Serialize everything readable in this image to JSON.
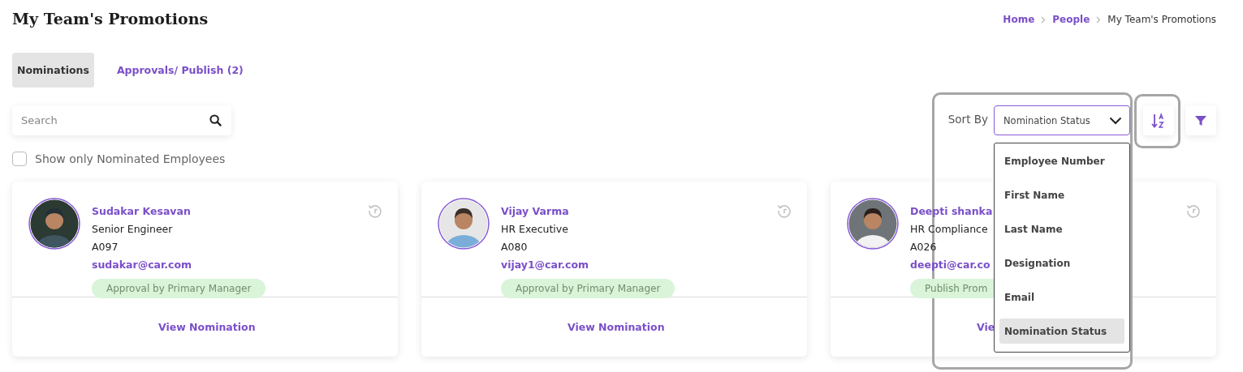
{
  "page_title": "My Team's Promotions",
  "breadcrumb": [
    {
      "label": "Home",
      "link": true
    },
    {
      "label": "People",
      "link": true
    },
    {
      "label": "My Team's Promotions",
      "link": false
    }
  ],
  "tabs": [
    {
      "label": "Nominations",
      "selected": true
    },
    {
      "label": "Approvals/ Publish (2)",
      "selected": false
    }
  ],
  "search": {
    "placeholder": "Search"
  },
  "show_only_nominated": {
    "label": "Show only Nominated Employees",
    "checked": false
  },
  "sort": {
    "label": "Sort By",
    "value": "Nomination Status",
    "options": [
      {
        "label": "Employee Number",
        "selected": false
      },
      {
        "label": "First Name",
        "selected": false
      },
      {
        "label": "Last Name",
        "selected": false
      },
      {
        "label": "Designation",
        "selected": false
      },
      {
        "label": "Email",
        "selected": false
      },
      {
        "label": "Nomination Status",
        "selected": true
      }
    ]
  },
  "cards": [
    {
      "name": "Sudakar Kesavan",
      "designation": "Senior Engineer",
      "employee_number": "A097",
      "email": "sudakar@car.com",
      "status": "Approval by Primary Manager",
      "action": "View Nomination"
    },
    {
      "name": "Vijay Varma",
      "designation": "HR Executive",
      "employee_number": "A080",
      "email": "vijay1@car.com",
      "status": "Approval by Primary Manager",
      "action": "View Nomination"
    },
    {
      "name": "Deepti shanka",
      "designation": "HR Compliance",
      "employee_number": "A026",
      "email": "deepti@car.co",
      "status": "Publish Prom",
      "action": "Vie"
    }
  ]
}
